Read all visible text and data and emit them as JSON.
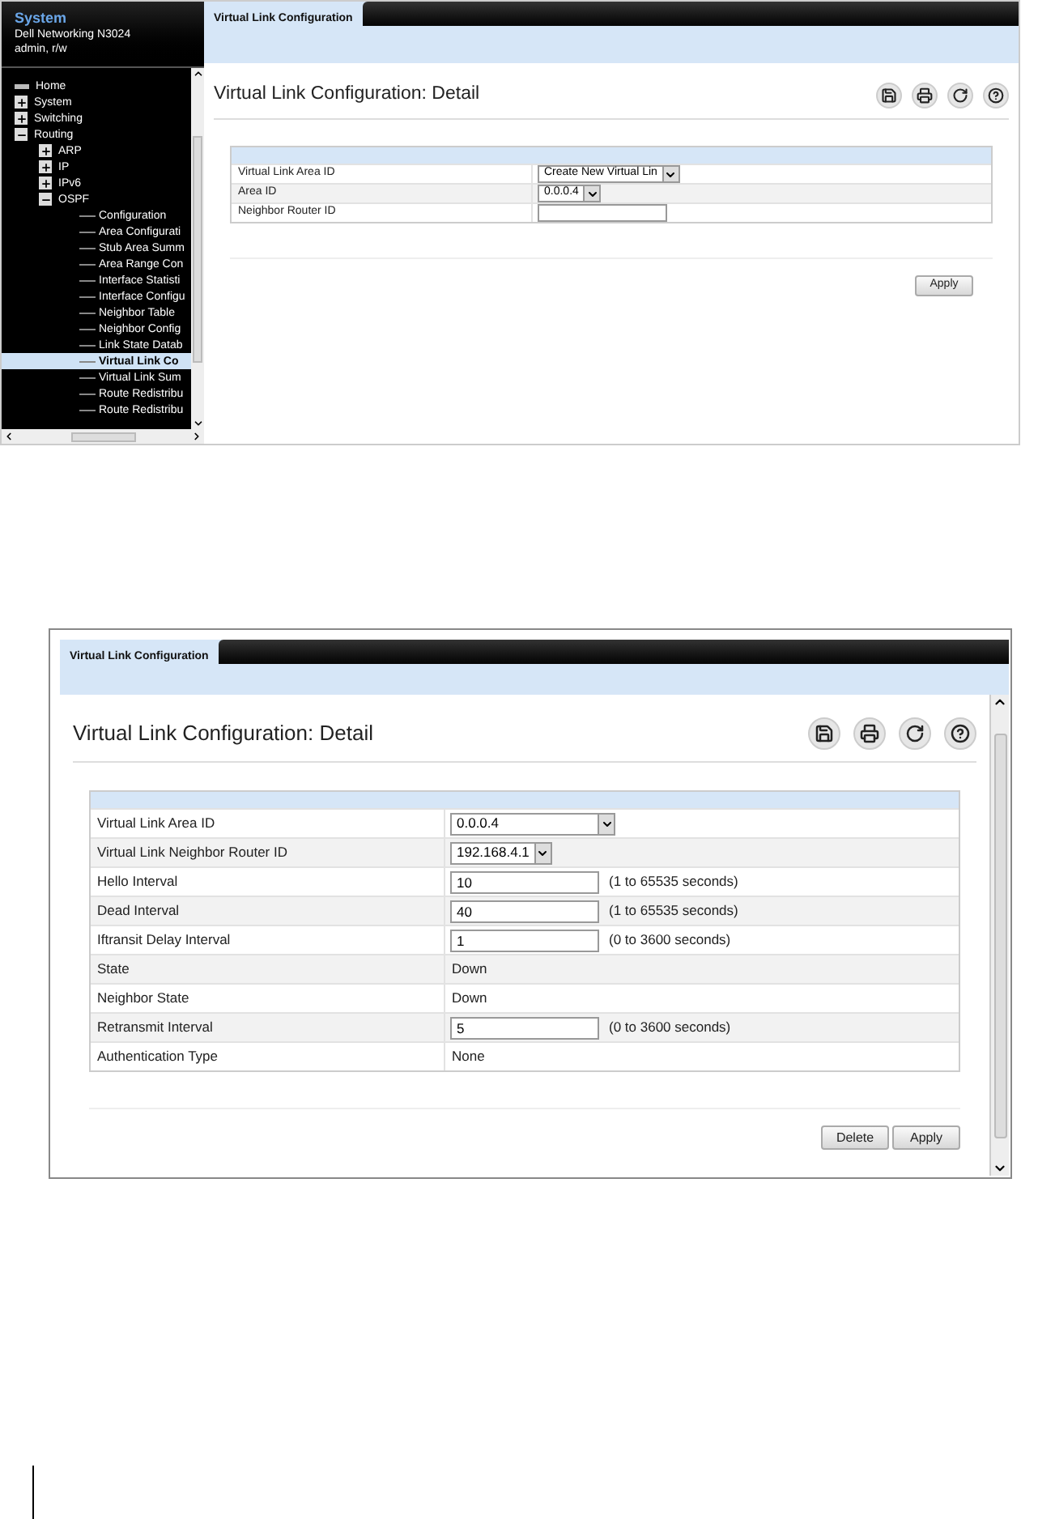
{
  "top_screen": {
    "sidebar": {
      "title": "System",
      "device": "Dell Networking N3024",
      "user": "admin, r/w",
      "tree": [
        {
          "label": "Home",
          "kind": "home",
          "selected": false
        },
        {
          "label": "System",
          "kind": "node",
          "expanded": false,
          "selected": false
        },
        {
          "label": "Switching",
          "kind": "node",
          "expanded": false,
          "selected": false
        },
        {
          "label": "Routing",
          "kind": "node",
          "expanded": true,
          "selected": false,
          "children": [
            {
              "label": "ARP",
              "kind": "node",
              "expanded": false,
              "selected": false
            },
            {
              "label": "IP",
              "kind": "node",
              "expanded": false,
              "selected": false
            },
            {
              "label": "IPv6",
              "kind": "node",
              "expanded": false,
              "selected": false
            },
            {
              "label": "OSPF",
              "kind": "node",
              "expanded": true,
              "selected": false,
              "children": [
                {
                  "label": "Configuration",
                  "kind": "page",
                  "selected": false
                },
                {
                  "label": "Area Configurati",
                  "kind": "page",
                  "selected": false
                },
                {
                  "label": "Stub Area Summ",
                  "kind": "page",
                  "selected": false
                },
                {
                  "label": "Area Range Con",
                  "kind": "page",
                  "selected": false
                },
                {
                  "label": "Interface Statisti",
                  "kind": "page",
                  "selected": false
                },
                {
                  "label": "Interface Configu",
                  "kind": "page",
                  "selected": false
                },
                {
                  "label": "Neighbor Table",
                  "kind": "page",
                  "selected": false
                },
                {
                  "label": "Neighbor Config",
                  "kind": "page",
                  "selected": false
                },
                {
                  "label": "Link State Datab",
                  "kind": "page",
                  "selected": false
                },
                {
                  "label": "Virtual Link Co",
                  "kind": "page",
                  "selected": true
                },
                {
                  "label": "Virtual Link Sum",
                  "kind": "page",
                  "selected": false
                },
                {
                  "label": "Route Redistribu",
                  "kind": "page",
                  "selected": false
                },
                {
                  "label": "Route Redistribu",
                  "kind": "page",
                  "selected": false
                }
              ]
            }
          ]
        }
      ]
    },
    "tabs": [
      {
        "label": "Virtual Link Configuration",
        "selected": true
      }
    ],
    "heading": "Virtual Link Configuration: Detail",
    "rows": [
      {
        "label": "Virtual Link Area ID",
        "kind": "select",
        "value": "Create New Virtual Lin"
      },
      {
        "label": "Area ID",
        "kind": "select",
        "value": "0.0.0.4"
      },
      {
        "label": "Neighbor Router ID",
        "kind": "input",
        "value": ""
      }
    ],
    "buttons": [
      "Apply"
    ]
  },
  "bottom_screen": {
    "tabs": [
      {
        "label": "Virtual Link Configuration",
        "selected": true
      }
    ],
    "heading": "Virtual Link Configuration: Detail",
    "rows": [
      {
        "label": "Virtual Link Area ID",
        "kind": "select",
        "value": "0.0.0.4"
      },
      {
        "label": "Virtual Link Neighbor Router ID",
        "kind": "select",
        "value": "192.168.4.1"
      },
      {
        "label": "Hello Interval",
        "kind": "input",
        "value": "10",
        "hint": "(1 to 65535 seconds)"
      },
      {
        "label": "Dead Interval",
        "kind": "input",
        "value": "40",
        "hint": "(1 to 65535 seconds)"
      },
      {
        "label": "Iftransit Delay Interval",
        "kind": "input",
        "value": "1",
        "hint": "(0 to 3600 seconds)"
      },
      {
        "label": "State",
        "kind": "text",
        "value": "Down"
      },
      {
        "label": "Neighbor State",
        "kind": "text",
        "value": "Down"
      },
      {
        "label": "Retransmit Interval",
        "kind": "input",
        "value": "5",
        "hint": "(0 to 3600 seconds)"
      },
      {
        "label": "Authentication Type",
        "kind": "text",
        "value": "None"
      }
    ],
    "buttons": [
      "Delete",
      "Apply"
    ]
  }
}
